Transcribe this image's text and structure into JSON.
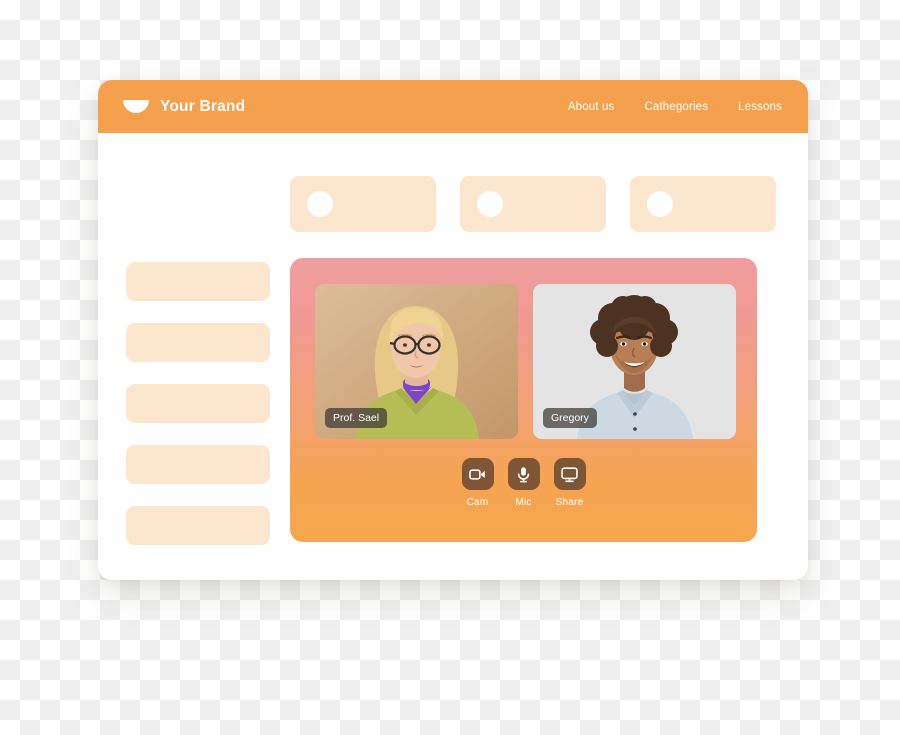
{
  "header": {
    "brand_name": "Your Brand",
    "logo_icon": "semicircle-logo-icon",
    "nav": [
      {
        "label": "About us",
        "name": "nav-about-us"
      },
      {
        "label": "Cathegories",
        "name": "nav-cathegories"
      },
      {
        "label": "Lessons",
        "name": "nav-lessons"
      }
    ]
  },
  "top_cards": [
    {
      "name": "placeholder-card-1"
    },
    {
      "name": "placeholder-card-2"
    },
    {
      "name": "placeholder-card-3"
    }
  ],
  "sidebar": {
    "items": [
      {
        "name": "sidebar-placeholder-1"
      },
      {
        "name": "sidebar-placeholder-2"
      },
      {
        "name": "sidebar-placeholder-3"
      },
      {
        "name": "sidebar-placeholder-4"
      },
      {
        "name": "sidebar-placeholder-5"
      }
    ]
  },
  "video_call": {
    "participants": [
      {
        "name_label": "Prof. Sael"
      },
      {
        "name_label": "Gregory"
      }
    ],
    "controls": [
      {
        "label": "Cam",
        "icon": "video-camera-icon"
      },
      {
        "label": "Mic",
        "icon": "microphone-icon"
      },
      {
        "label": "Share",
        "icon": "screen-share-icon"
      }
    ]
  },
  "colors": {
    "brand_orange": "#F5A04C",
    "peach_placeholder": "#FCE6CD",
    "panel_gradient_top": "#EF9D9E",
    "panel_gradient_bottom": "#F6A74E",
    "control_button": "#7E5636",
    "card_background": "#FFFFFF"
  }
}
